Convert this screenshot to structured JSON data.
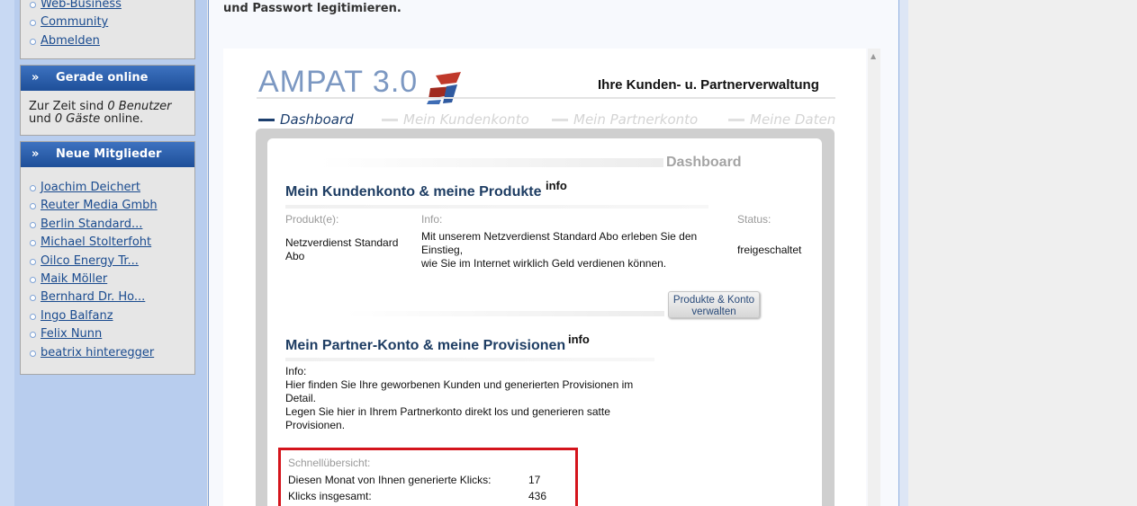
{
  "sidebar": {
    "top_links": [
      "Web-Business",
      "Community",
      "Abmelden"
    ],
    "online_box": {
      "title": "Gerade online",
      "text_prefix": "Zur Zeit sind ",
      "users": "0 Benutzer",
      "text_mid": "und ",
      "guests": "0 Gäste",
      "text_suffix": " online."
    },
    "members_box": {
      "title": "Neue Mitglieder",
      "members": [
        "Joachim Deichert",
        "Reuter Media Gmbh",
        "Berlin Standard...",
        "Michael Stolterfoht",
        "Oilco Energy Tr...",
        "Maik Möller",
        "Bernhard Dr. Ho...",
        "Ingo Balfanz",
        "Felix Nunn",
        "beatrix hinteregger"
      ]
    }
  },
  "main": {
    "top_text": "und Passwort legitimieren."
  },
  "ampat": {
    "logo_text": "AMPAT 3.0",
    "slogan": "Ihre Kunden- u. Partnerverwaltung",
    "tabs": [
      "Dashboard",
      "Mein Kundenkonto",
      "Mein Partnerkonto",
      "Meine Daten"
    ],
    "dashboard_title": "Dashboard",
    "customer_section": {
      "title": "Mein Kundenkonto & meine Produkte",
      "info_sup": "info",
      "col_product": "Produkt(e):",
      "col_info": "Info:",
      "col_status": "Status:",
      "product_line1": "Netzverdienst Standard",
      "product_line2": "Abo",
      "info_line1": "Mit unserem Netzverdienst Standard Abo erleben Sie den",
      "info_line2": "Einstieg,",
      "info_line3": "wie Sie im Internet wirklich Geld verdienen können.",
      "status": "freigeschaltet",
      "button_line1": "Produkte & Konto",
      "button_line2": "verwalten"
    },
    "partner_section": {
      "title": "Mein Partner-Konto & meine Provisionen",
      "info_sup": "info",
      "info_label": "Info:",
      "info_line1": "Hier finden Sie Ihre geworbenen Kunden und generierten Provisionen im",
      "info_line2": "Detail.",
      "info_line3": "Legen Sie hier in Ihrem Partnerkonto direkt los und generieren satte",
      "info_line4": "Provisionen.",
      "overview_label": "Schnellübersicht:",
      "month_clicks_label": "Diesen Monat von Ihnen generierte Klicks:",
      "month_clicks_value": "17",
      "total_clicks_label": "Klicks insgesamt:",
      "total_clicks_value": "436"
    }
  },
  "colors": {
    "sidebar_header": "#2a5fae",
    "highlight": "#d4141c",
    "section_title": "#1e3d63"
  }
}
